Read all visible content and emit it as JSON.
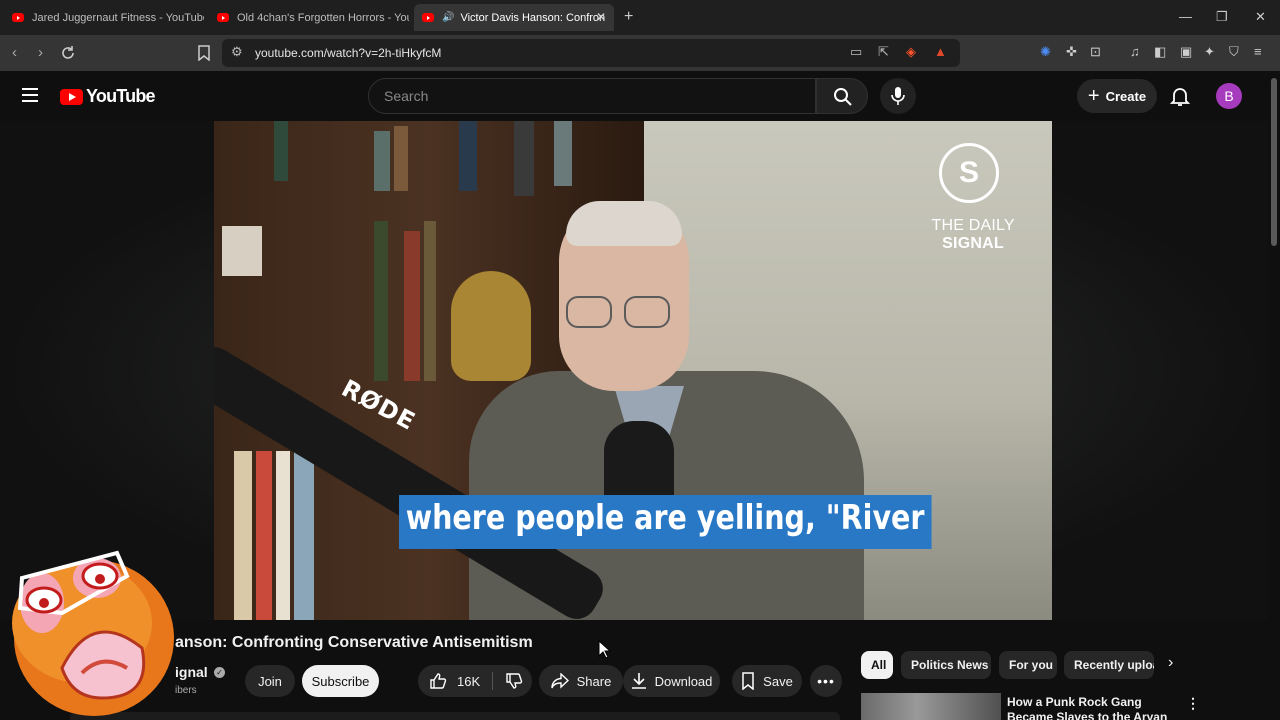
{
  "browser": {
    "tabs": [
      {
        "title": "Jared Juggernaut Fitness - YouTube",
        "active": false
      },
      {
        "title": "Old 4chan's Forgotten Horrors - YouT",
        "active": false
      },
      {
        "title": "Victor Davis Hanson: Confron",
        "active": true
      }
    ],
    "url": "youtube.com/watch?v=2h-tiHkyfcM",
    "new_tab": "+"
  },
  "youtube": {
    "logo_text": "YouTube",
    "search_placeholder": "Search",
    "create_label": "Create",
    "avatar_letter": "B"
  },
  "video": {
    "watermark_top": "THE DAILY",
    "watermark_bold": "SIGNAL",
    "mic_brand": "RØDE",
    "caption": "where people are yelling, \"River",
    "title_visible": "anson: Confronting Conservative Antisemitism",
    "channel_visible": "ignal",
    "subscribers_visible": "ibers"
  },
  "actions": {
    "join": "Join",
    "subscribe": "Subscribe",
    "likes": "16K",
    "share": "Share",
    "download": "Download",
    "save": "Save"
  },
  "chips": [
    "All",
    "Politics News",
    "For you",
    "Recently uploa"
  ],
  "recommendation": {
    "title": "How a Punk Rock Gang Became Slaves to the Aryan Brotherho"
  },
  "colors": {
    "yt_red": "#ff0000",
    "caption_bg": "#2878c5",
    "avatar": "#a73bbd",
    "background": "#0f0f0f"
  }
}
